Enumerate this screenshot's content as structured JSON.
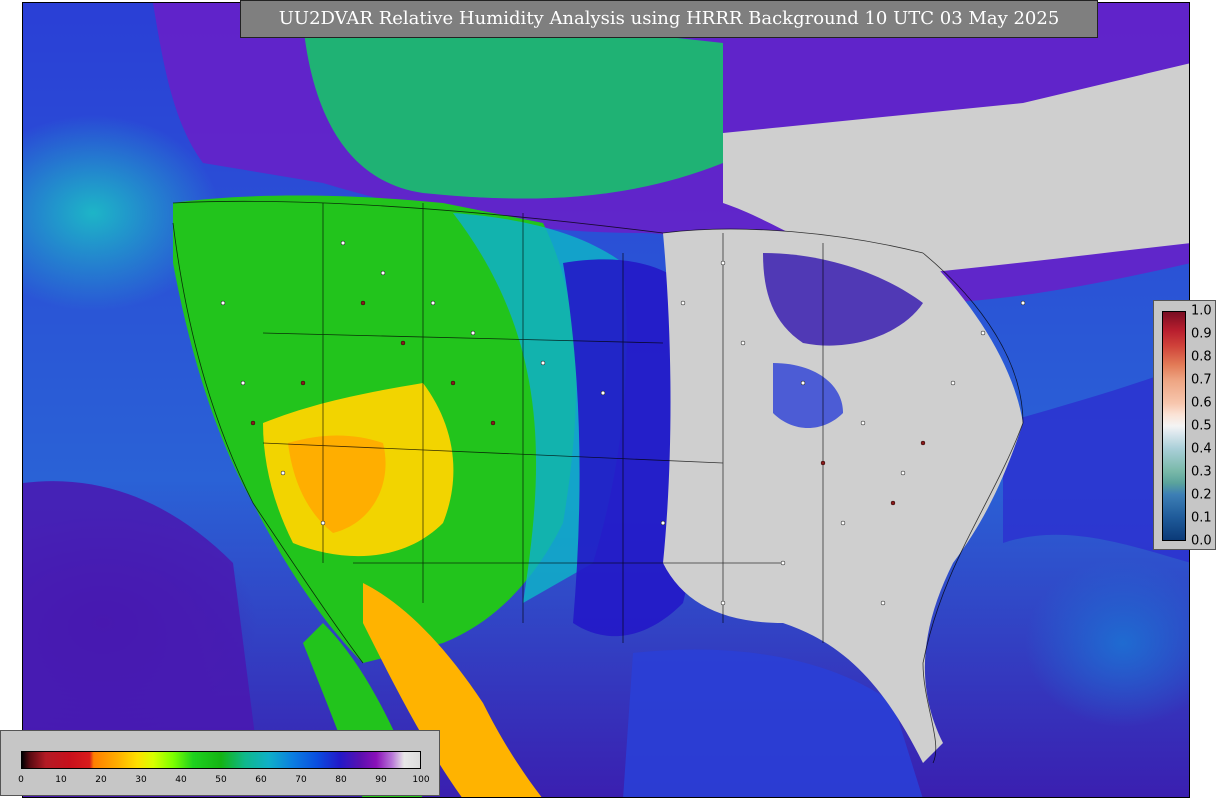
{
  "title": "UU2DVAR Relative Humidity Analysis using HRRR Background 10 UTC 03 May 2025",
  "main_colorbar": {
    "ticks": [
      "0",
      "10",
      "20",
      "30",
      "40",
      "50",
      "60",
      "70",
      "80",
      "90",
      "100"
    ]
  },
  "side_colorbar": {
    "ticks": [
      "1.0",
      "0.9",
      "0.8",
      "0.7",
      "0.6",
      "0.5",
      "0.4",
      "0.3",
      "0.2",
      "0.1",
      "0.0"
    ]
  },
  "colors": {
    "title_bg": "#7f7f7f",
    "colorbar_bg": "#c6c6c6",
    "land_dry_west": "#1ed11e",
    "land_very_dry": "#ffae00",
    "land_saturated_east": "#cfcfcf",
    "ocean": "#2a3fd6"
  }
}
